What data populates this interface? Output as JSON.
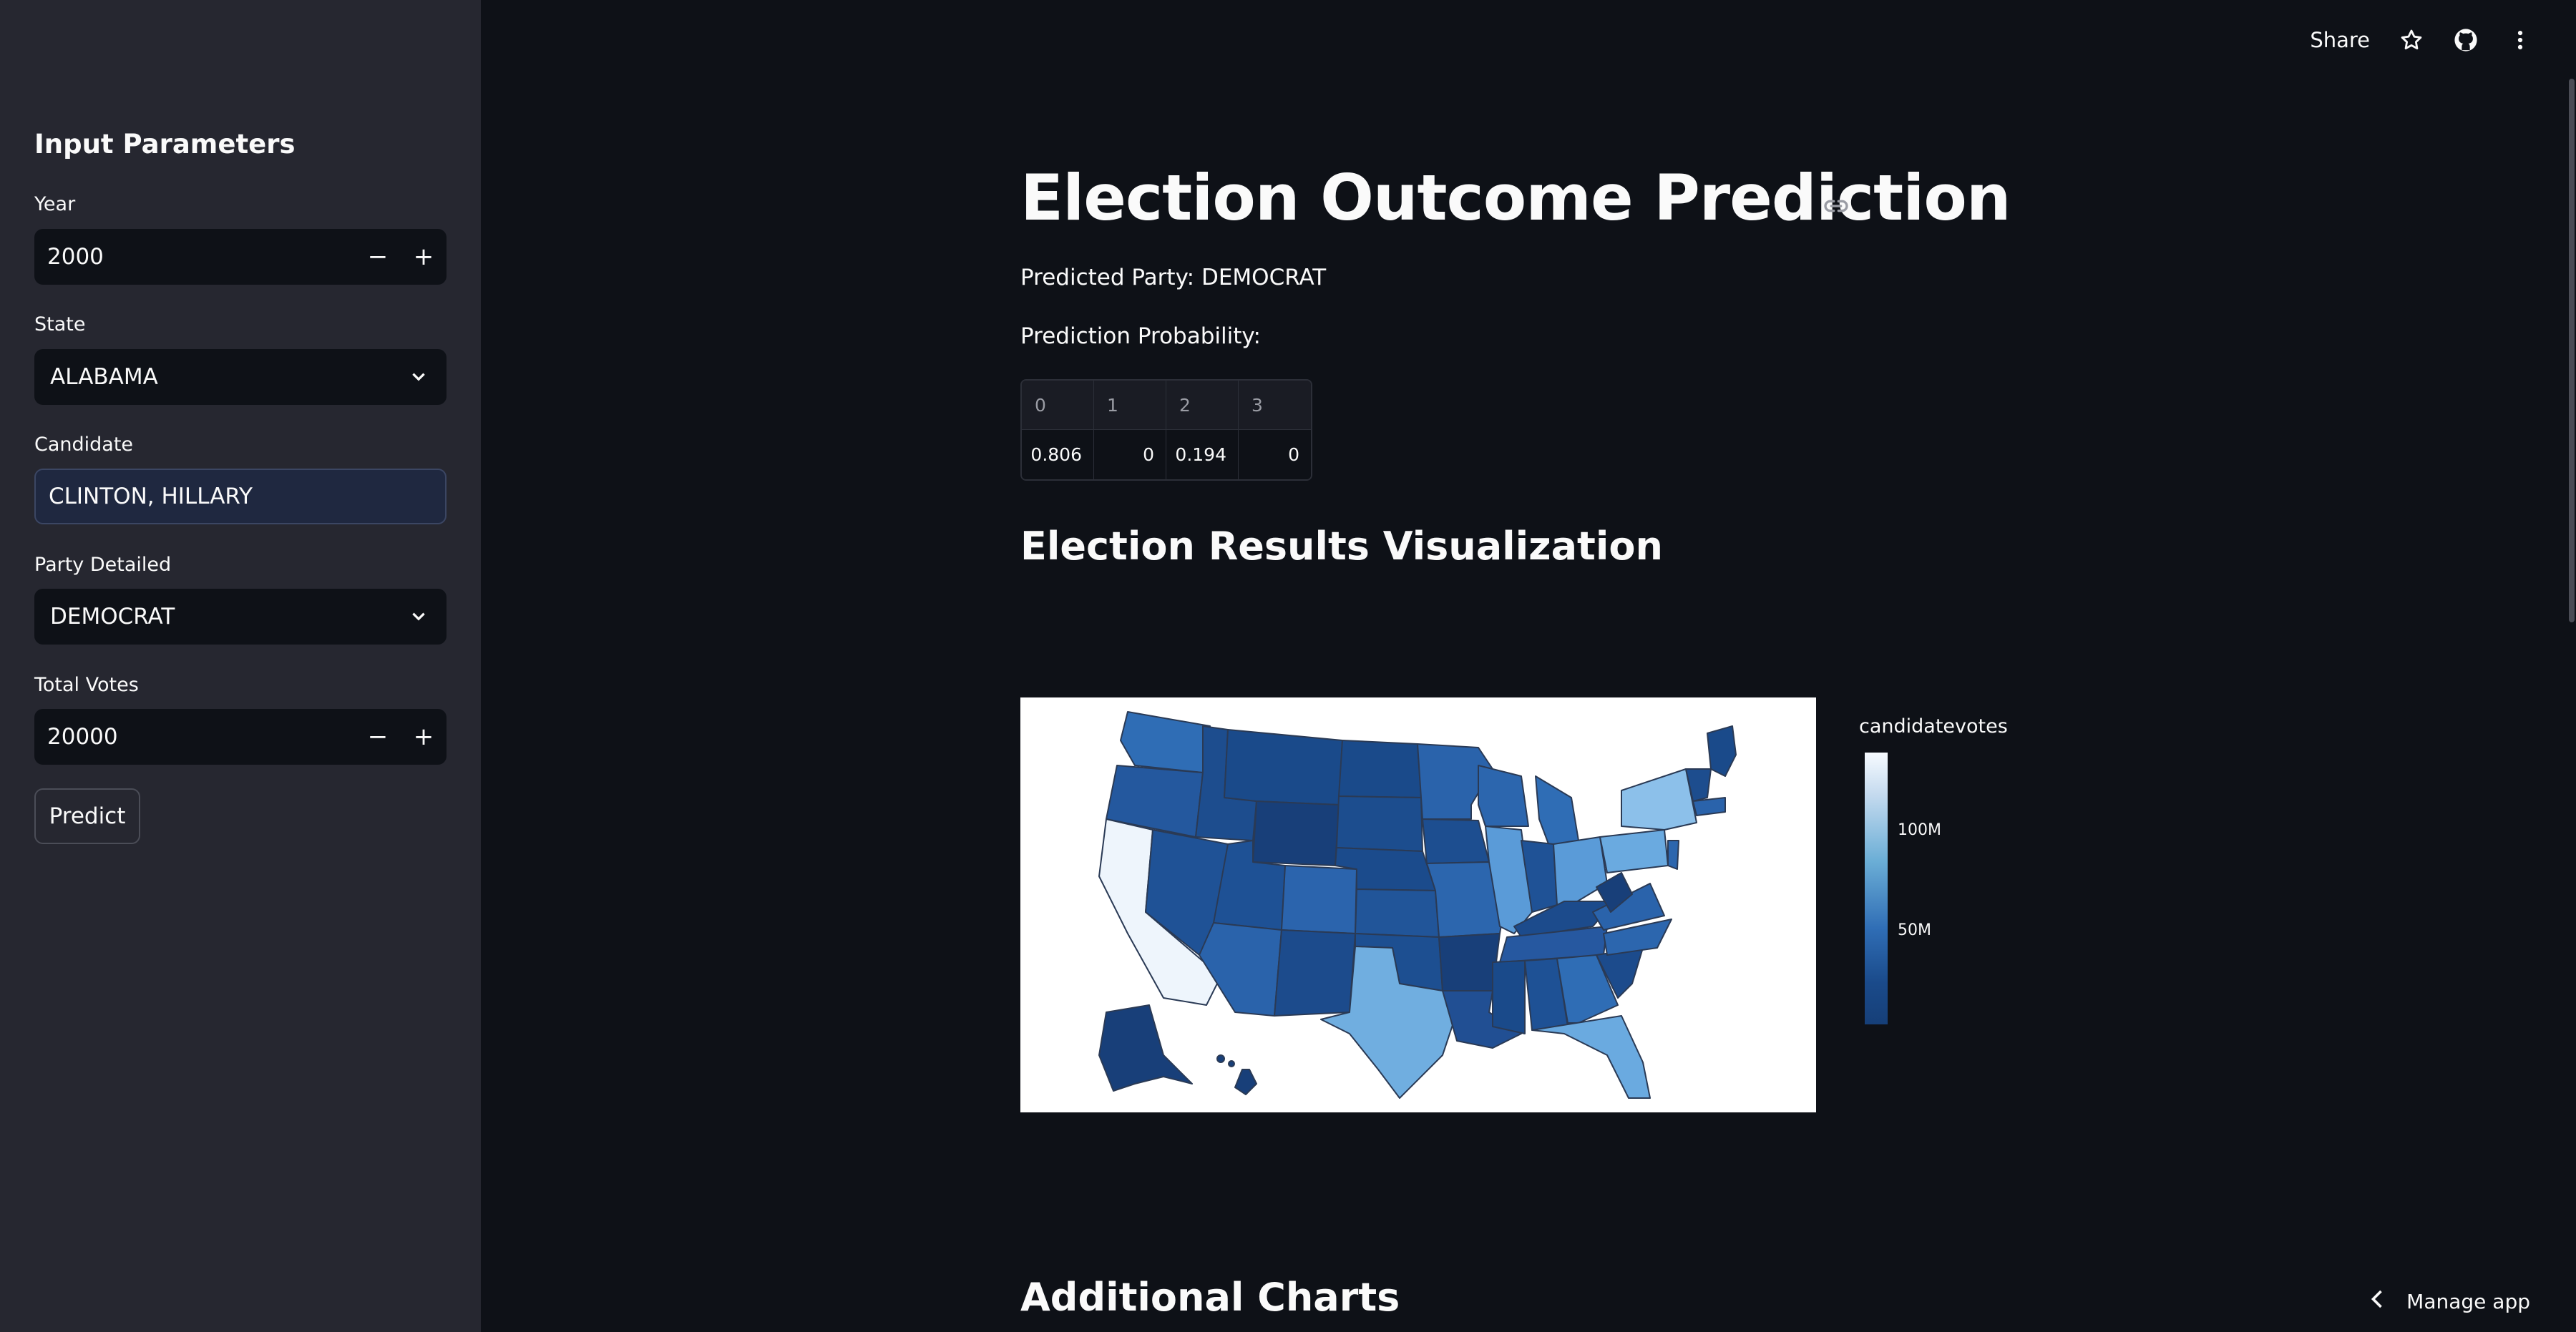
{
  "sidebar": {
    "title": "Input Parameters",
    "year_label": "Year",
    "year_value": "2000",
    "state_label": "State",
    "state_value": "ALABAMA",
    "candidate_label": "Candidate",
    "candidate_value": "CLINTON, HILLARY",
    "party_label": "Party Detailed",
    "party_value": "DEMOCRAT",
    "votes_label": "Total Votes",
    "votes_value": "20000",
    "predict_label": "Predict",
    "minus": "−",
    "plus": "+"
  },
  "header": {
    "share_label": "Share"
  },
  "main": {
    "title": "Election Outcome Prediction",
    "predicted_party": "Predicted Party: DEMOCRAT",
    "prob_label": "Prediction Probability:",
    "prob_table": {
      "headers": [
        "0",
        "1",
        "2",
        "3"
      ],
      "values": [
        "0.806",
        "0",
        "0.194",
        "0"
      ]
    },
    "viz_heading": "Election Results Visualization",
    "additional_heading": "Additional Charts"
  },
  "chart_data": {
    "type": "choropleth",
    "colorbar_title": "candidatevotes",
    "colorbar_ticks": [
      "100M",
      "50M"
    ],
    "colorscale": [
      "#163f78",
      "#2f6db5",
      "#6baed6",
      "#c6dbef",
      "#f7fbff"
    ]
  },
  "footer": {
    "manage_label": "Manage app"
  }
}
